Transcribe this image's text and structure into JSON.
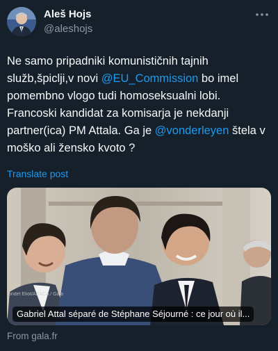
{
  "author": {
    "display_name": "Aleš Hojs",
    "handle": "@aleshojs"
  },
  "tweet": {
    "text_1": "Ne samo pripadniki komunističnih tajnih služb,špiclji,v novi ",
    "mention_1": "@EU_Commission",
    "text_2": " bo imel pomembno vlogo tudi homoseksualni lobi. Francoski kandidat za komisarja je nekdanji partner(ica) PM Attala. Ga je ",
    "mention_2": "@vonderleyen",
    "text_3": " štela v moško ali žensko kvoto ?"
  },
  "translate_label": "Translate post",
  "card": {
    "credit": "ondet Eliot/ABACA / Gala",
    "title": "Gabriel Attal séparé de Stéphane Séjourné : ce jour où il...",
    "source": "From gala.fr"
  },
  "icons": {
    "more": "more-icon"
  },
  "colors": {
    "background": "#15202b",
    "link": "#1d9bf0",
    "muted": "#8b98a5",
    "text": "#f7f9f9"
  }
}
